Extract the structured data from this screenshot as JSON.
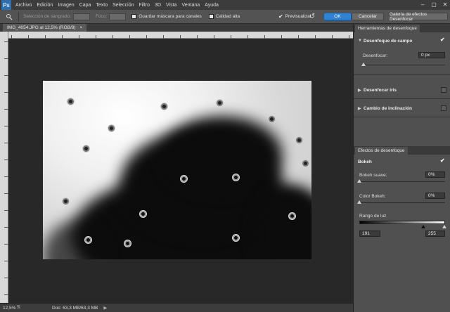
{
  "app": {
    "logo": "Ps",
    "menu": [
      "Archivo",
      "Edición",
      "Imagen",
      "Capa",
      "Texto",
      "Selección",
      "Filtro",
      "3D",
      "Vista",
      "Ventana",
      "Ayuda"
    ],
    "window_controls": [
      "–",
      "▢",
      "✕"
    ]
  },
  "options": {
    "tool_icon": "pin-tool-icon",
    "selection_label": "Selección de sangrado:",
    "focus_label": "Foco:",
    "save_mask_label": "Guardar máscara para canales",
    "high_quality_label": "Calidad alta",
    "preview_label": "Previsualizar",
    "ok_label": "OK",
    "cancel_label": "Cancelar",
    "gallery_label": "Galería de efectos Desenfocar"
  },
  "document": {
    "tab_title": "IMG_4054.JPG al 12,5% (RGB/8)",
    "tab_close": "×"
  },
  "status": {
    "zoom": "12,5%",
    "doc_info": "Doc: 63,3 MB/63,3 MB",
    "arrow": "▶"
  },
  "panel_tools": {
    "tab": "Herramientas de desenfoque",
    "field_blur": {
      "label": "Desenfoque de campo",
      "enabled": true,
      "blur_label": "Desenfocar:",
      "blur_value": "0 px"
    },
    "iris_blur": {
      "label": "Desenfocar iris",
      "enabled": false
    },
    "tilt_shift": {
      "label": "Cambio de inclinación",
      "enabled": false
    }
  },
  "panel_effects": {
    "tab": "Efectos de desenfoque",
    "bokeh": {
      "label": "Bokeh",
      "enabled": true
    },
    "bokeh_soft": {
      "label": "Bokeh suave:",
      "value": "0%"
    },
    "bokeh_color": {
      "label": "Color Bokeh:",
      "value": "0%"
    },
    "light_range": {
      "label": "Rango de luz",
      "low": "191",
      "high": "255"
    }
  },
  "colors": {
    "accent": "#2f82d4",
    "panel_bg": "#505050",
    "app_bg": "#262626"
  }
}
